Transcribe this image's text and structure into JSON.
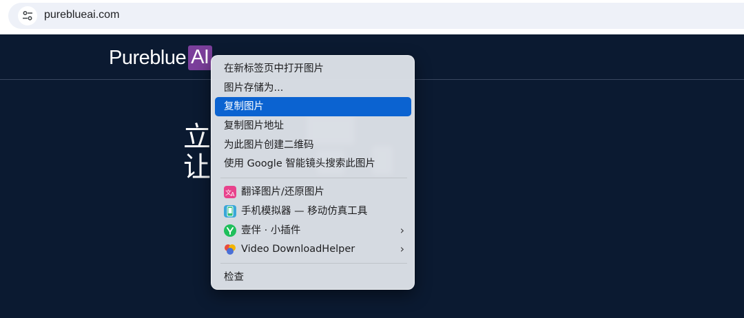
{
  "address_bar": {
    "url": "pureblueai.com",
    "icon": "tune-icon"
  },
  "site": {
    "logo_main": "Pureblue",
    "logo_badge": "AI",
    "hero_line1": "立",
    "hero_line2": "让"
  },
  "context_menu": {
    "items": [
      {
        "label": "在新标签页中打开图片"
      },
      {
        "label": "图片存储为..."
      },
      {
        "label": "复制图片",
        "highlighted": true
      },
      {
        "label": "复制图片地址"
      },
      {
        "label": "为此图片创建二维码"
      },
      {
        "label": "使用 Google 智能镜头搜索此图片"
      },
      {
        "label": "翻译图片/还原图片",
        "icon": "translate-icon"
      },
      {
        "label": "手机模拟器 — 移动仿真工具",
        "icon": "phone-emulator-icon"
      },
      {
        "label": "壹伴 · 小插件",
        "icon": "yiban-icon",
        "submenu": true
      },
      {
        "label": "Video DownloadHelper",
        "icon": "video-downloadhelper-icon",
        "submenu": true
      },
      {
        "label": "检查"
      }
    ],
    "submenu_arrow": "›",
    "highlight_color": "#0b63d1"
  },
  "colors": {
    "page_background": "#0b1a31",
    "logo_badge": "#7b3f9b"
  }
}
